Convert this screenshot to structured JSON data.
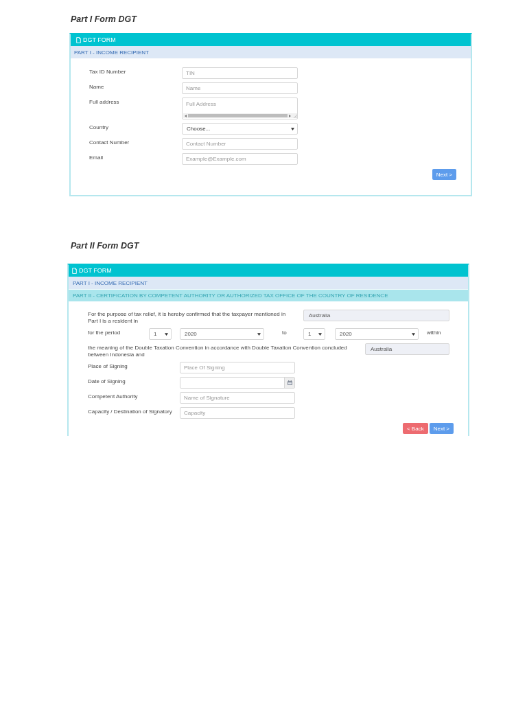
{
  "sections": [
    {
      "title": "Part I Form DGT",
      "panel": {
        "header": "DGT FORM",
        "parts": [
          {
            "label": "PART I - INCOME RECIPIENT",
            "color": "#dde8f6"
          }
        ],
        "fields": [
          {
            "label": "Tax ID Number",
            "kind": "text",
            "placeholder": "TIN"
          },
          {
            "label": "Name",
            "kind": "text",
            "placeholder": "Name"
          },
          {
            "label": "Full address",
            "kind": "textarea",
            "placeholder": "Full Address"
          },
          {
            "label": "Country",
            "kind": "select",
            "value": "Choose..."
          },
          {
            "label": "Contact Number",
            "kind": "text",
            "placeholder": "Contact Number"
          },
          {
            "label": "Email",
            "kind": "text",
            "placeholder": "Example@Example.com"
          }
        ],
        "buttons": [
          {
            "label": "Next >",
            "kind": "primary"
          }
        ]
      }
    },
    {
      "title": "Part II Form DGT",
      "panel": {
        "header": "DGT FORM",
        "parts": [
          {
            "label": "PART I - INCOME RECIPIENT",
            "color": "#dde8f6"
          },
          {
            "label": "PART II - CERTIFICATION BY COMPETENT AUTHORITY OR AUTHORIZED TAX OFFICE OF THE COUNTRY OF RESIDENCE",
            "color": "#a9e5ec"
          }
        ],
        "certification": {
          "residence_text": "For the purpose of tax relief, it is hereby confirmed that the taxpayer mentioned in Part I is a resident in",
          "residence_country": {
            "value": "Australia",
            "disabled": true
          },
          "period_label": "for the period",
          "from_month": "1",
          "from_year": "2020",
          "to_label": "to",
          "to_month": "1",
          "to_year": "2020",
          "within_label": "within",
          "convention_text": "the meaning of the Double Taxation Convention in accordance with Double Taxation Convention concluded between Indonesia and",
          "convention_country": {
            "value": "Australia",
            "disabled": true
          }
        },
        "fields": [
          {
            "label": "Place of Signing",
            "kind": "text",
            "placeholder": "Place Of Signing"
          },
          {
            "label": "Date of Signing",
            "kind": "date"
          },
          {
            "label": "Competent Authority",
            "kind": "text",
            "placeholder": "Name of Signature"
          },
          {
            "label": "Capacity / Destination of Signatory",
            "kind": "text",
            "placeholder": "Capacity"
          }
        ],
        "buttons": [
          {
            "label": "< Back",
            "kind": "danger"
          },
          {
            "label": "Next >",
            "kind": "primary"
          }
        ]
      }
    }
  ]
}
